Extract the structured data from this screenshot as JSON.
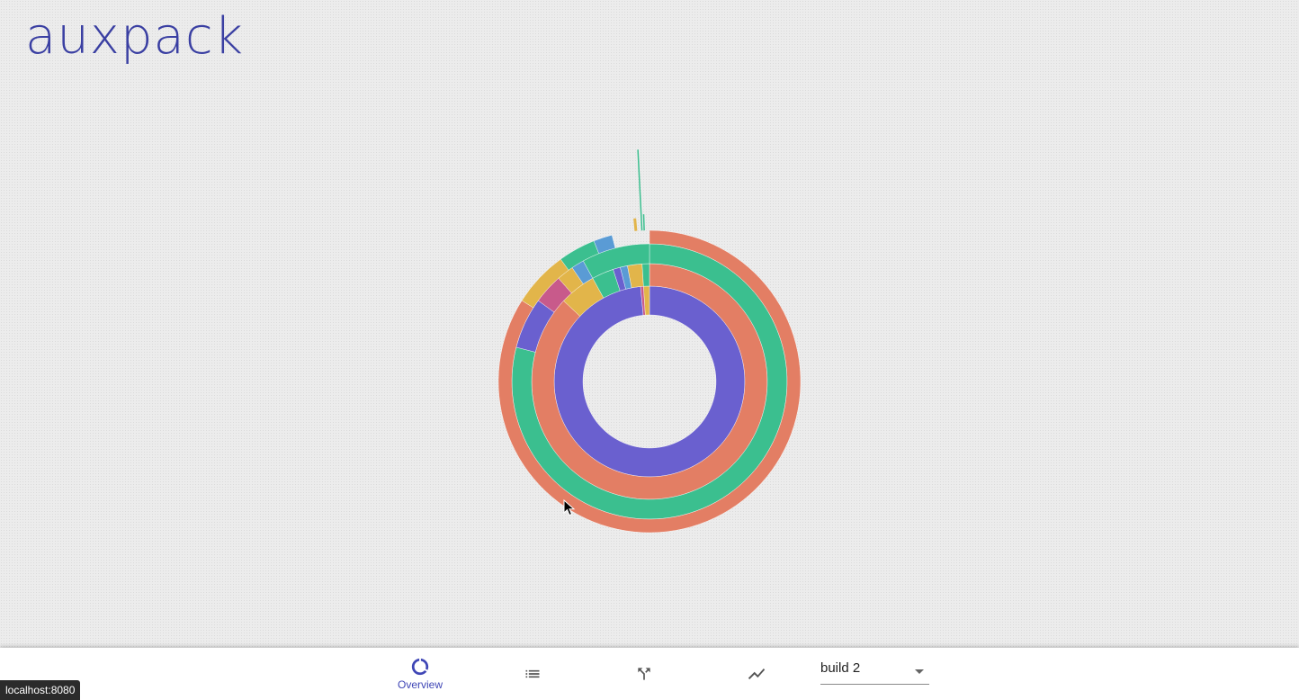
{
  "app": {
    "logo_text": "auxpack"
  },
  "colors": {
    "brand": "#3a3fa2",
    "purple": "#6a60cf",
    "orange": "#e37e64",
    "green": "#3bbf8f",
    "yellow": "#e2b54a",
    "pink": "#c85a8b",
    "blue": "#5a9bd5"
  },
  "sunburst": {
    "rings": [
      {
        "arcs": [
          {
            "color": "purple",
            "share": 0.985
          },
          {
            "color": "pink",
            "share": 0.005
          },
          {
            "color": "yellow",
            "share": 0.01
          }
        ]
      },
      {
        "arcs": [
          {
            "color": "orange",
            "share": 0.87
          },
          {
            "color": "yellow",
            "share": 0.05
          },
          {
            "color": "green",
            "share": 0.03
          },
          {
            "color": "purple",
            "share": 0.01
          },
          {
            "color": "blue",
            "share": 0.01
          },
          {
            "color": "yellow",
            "share": 0.02
          },
          {
            "color": "green",
            "share": 0.01
          }
        ]
      },
      {
        "arcs": [
          {
            "color": "green",
            "share": 0.79
          },
          {
            "color": "purple",
            "share": 0.06
          },
          {
            "color": "pink",
            "share": 0.035
          },
          {
            "color": "yellow",
            "share": 0.02
          },
          {
            "color": "blue",
            "share": 0.015
          },
          {
            "color": "green",
            "share": 0.08
          }
        ]
      },
      {
        "arcs": [
          {
            "color": "orange",
            "share": 0.84
          },
          {
            "color": "yellow",
            "share": 0.06
          },
          {
            "color": "green",
            "share": 0.04
          },
          {
            "color": "blue",
            "share": 0.02
          }
        ]
      }
    ]
  },
  "bottom_nav": {
    "items": [
      {
        "label": "Overview",
        "icon": "donut-chart-icon",
        "active": true
      },
      {
        "label": "",
        "icon": "list-icon",
        "active": false
      },
      {
        "label": "",
        "icon": "merge-icon",
        "active": false
      },
      {
        "label": "",
        "icon": "trending-icon",
        "active": false
      }
    ],
    "build_select": {
      "value": "build 2"
    }
  },
  "status_bar": {
    "url": "localhost:8080"
  }
}
